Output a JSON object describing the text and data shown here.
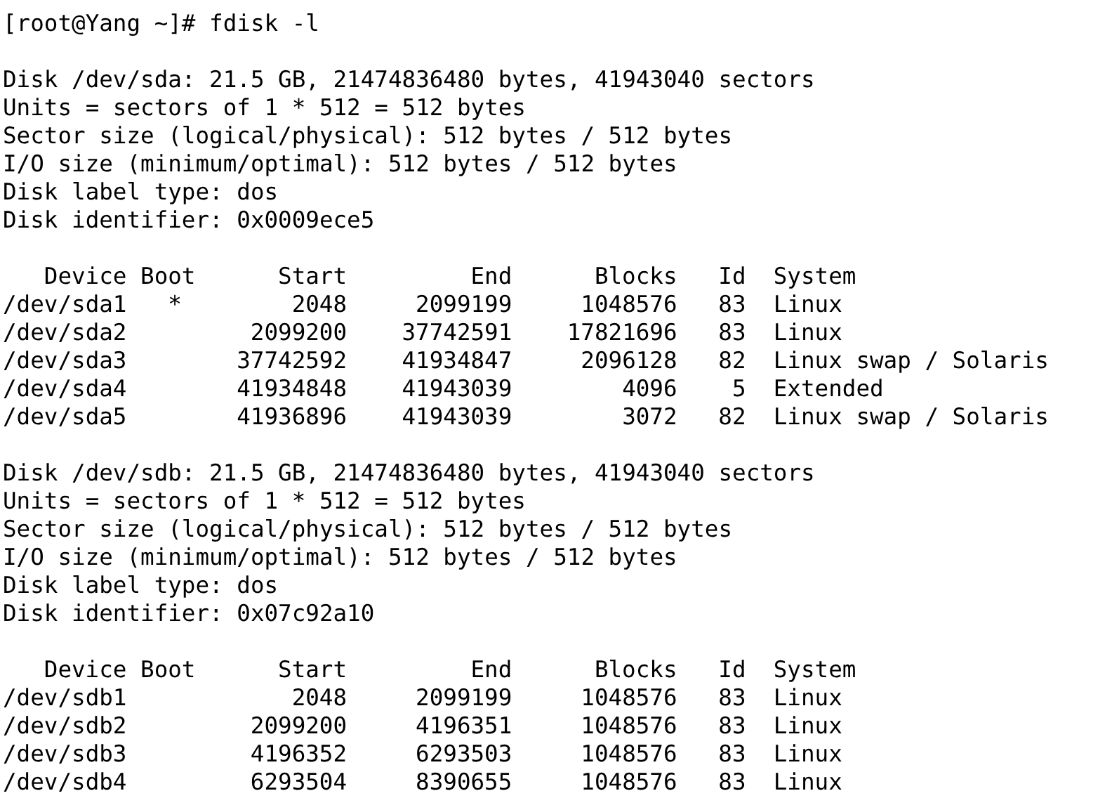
{
  "prompt": "[root@Yang ~]# fdisk -l",
  "disks": [
    {
      "info": [
        "Disk /dev/sda: 21.5 GB, 21474836480 bytes, 41943040 sectors",
        "Units = sectors of 1 * 512 = 512 bytes",
        "Sector size (logical/physical): 512 bytes / 512 bytes",
        "I/O size (minimum/optimal): 512 bytes / 512 bytes",
        "Disk label type: dos",
        "Disk identifier: 0x0009ece5"
      ],
      "table": {
        "columns": [
          "Device",
          "Boot",
          "Start",
          "End",
          "Blocks",
          "Id",
          "System"
        ],
        "rows": [
          {
            "device": "/dev/sda1",
            "boot": "*",
            "start": "2048",
            "end": "2099199",
            "blocks": "1048576",
            "id": "83",
            "system": "Linux"
          },
          {
            "device": "/dev/sda2",
            "start": "2099200",
            "end": "37742591",
            "blocks": "17821696",
            "id": "83",
            "system": "Linux"
          },
          {
            "device": "/dev/sda3",
            "start": "37742592",
            "end": "41934847",
            "blocks": "2096128",
            "id": "82",
            "system": "Linux swap / Solaris"
          },
          {
            "device": "/dev/sda4",
            "start": "41934848",
            "end": "41943039",
            "blocks": "4096",
            "id": "5",
            "system": "Extended"
          },
          {
            "device": "/dev/sda5",
            "start": "41936896",
            "end": "41943039",
            "blocks": "3072",
            "id": "82",
            "system": "Linux swap / Solaris"
          }
        ]
      }
    },
    {
      "info": [
        "Disk /dev/sdb: 21.5 GB, 21474836480 bytes, 41943040 sectors",
        "Units = sectors of 1 * 512 = 512 bytes",
        "Sector size (logical/physical): 512 bytes / 512 bytes",
        "I/O size (minimum/optimal): 512 bytes / 512 bytes",
        "Disk label type: dos",
        "Disk identifier: 0x07c92a10"
      ],
      "table": {
        "columns": [
          "Device",
          "Boot",
          "Start",
          "End",
          "Blocks",
          "Id",
          "System"
        ],
        "rows": [
          {
            "device": "/dev/sdb1",
            "start": "2048",
            "end": "2099199",
            "blocks": "1048576",
            "id": "83",
            "system": "Linux"
          },
          {
            "device": "/dev/sdb2",
            "start": "2099200",
            "end": "4196351",
            "blocks": "1048576",
            "id": "83",
            "system": "Linux"
          },
          {
            "device": "/dev/sdb3",
            "start": "4196352",
            "end": "6293503",
            "blocks": "1048576",
            "id": "83",
            "system": "Linux"
          },
          {
            "device": "/dev/sdb4",
            "start": "6293504",
            "end": "8390655",
            "blocks": "1048576",
            "id": "83",
            "system": "Linux"
          }
        ]
      }
    }
  ]
}
